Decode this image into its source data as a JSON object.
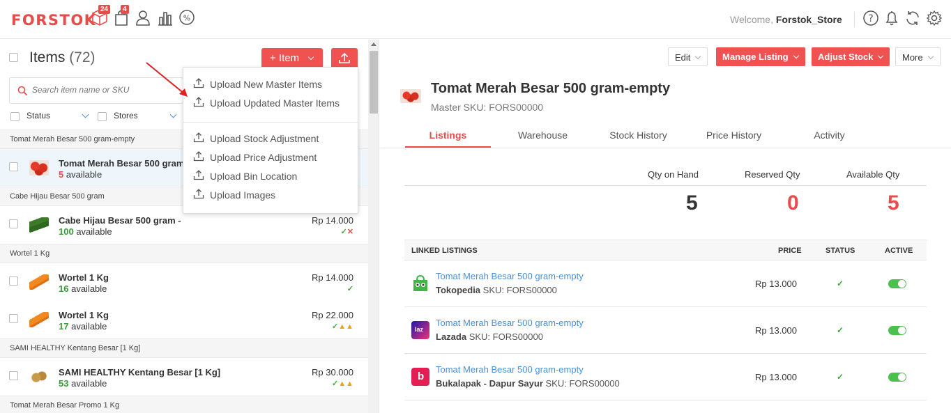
{
  "topbar": {
    "logo": "FORSTOK",
    "orders_badge": "24",
    "returns_badge": "4",
    "welcome_prefix": "Welcome,",
    "store_name": "Forstok_Store",
    "icons": [
      "box-icon",
      "bag-icon",
      "user-icon",
      "chart-icon",
      "discount-icon",
      "help-icon",
      "bell-icon",
      "sync-icon",
      "gear-icon"
    ]
  },
  "items_panel": {
    "title": "Items",
    "count": "(72)",
    "add_item_label": "+ Item",
    "search_placeholder": "Search item name or SKU",
    "filters": [
      {
        "label": "Status"
      },
      {
        "label": "Stores"
      }
    ],
    "groups": [
      {
        "name": "Tomat Merah Besar 500 gram-empty"
      },
      {
        "name": "Cabe Hijau Besar 500 gram"
      },
      {
        "name": "Wortel 1 Kg"
      },
      {
        "name": "SAMI HEALTHY Kentang Besar [1 Kg]"
      },
      {
        "name": "Tomat Merah Besar Promo 1 Kg"
      }
    ],
    "rows": [
      {
        "name": "Tomat Merah Besar 500 gram-empty",
        "qty": "5",
        "avail": "available",
        "price": ""
      },
      {
        "name": "Cabe Hijau Besar 500 gram -",
        "qty": "100",
        "avail": "available",
        "price": "Rp 14.000"
      },
      {
        "name": "Wortel 1 Kg",
        "qty": "16",
        "avail": "available",
        "price": "Rp 14.000"
      },
      {
        "name": "Wortel 1 Kg",
        "qty": "17",
        "avail": "available",
        "price": "Rp 22.000"
      },
      {
        "name": "SAMI HEALTHY Kentang Besar [1 Kg]",
        "qty": "53",
        "avail": "available",
        "price": "Rp 30.000"
      }
    ]
  },
  "upload_menu": {
    "items": [
      {
        "label": "Upload New Master Items"
      },
      {
        "label": "Upload Updated Master Items"
      },
      {
        "label": "Upload Stock Adjustment"
      },
      {
        "label": "Upload Price Adjustment"
      },
      {
        "label": "Upload Bin Location"
      },
      {
        "label": "Upload Images"
      }
    ]
  },
  "detail": {
    "buttons": {
      "edit": "Edit",
      "manage_listing": "Manage Listing",
      "adjust_stock": "Adjust Stock",
      "more": "More"
    },
    "title": "Tomat Merah Besar 500 gram-empty",
    "master_sku": "Master SKU: FORS00000",
    "tabs": [
      {
        "label": "Listings"
      },
      {
        "label": "Warehouse"
      },
      {
        "label": "Stock History"
      },
      {
        "label": "Price History"
      },
      {
        "label": "Activity"
      }
    ],
    "qty": {
      "on_hand_label": "Qty on Hand",
      "on_hand": "5",
      "reserved_label": "Reserved Qty",
      "reserved": "0",
      "available_label": "Available Qty",
      "available": "5"
    },
    "listings_header": {
      "linked": "LINKED LISTINGS",
      "price": "PRICE",
      "status": "STATUS",
      "active": "ACTIVE"
    },
    "listings": [
      {
        "name": "Tomat Merah Besar 500 gram-empty",
        "store": "Tokopedia",
        "sku": "SKU: FORS00000",
        "price": "Rp  13.000",
        "status": "✓",
        "active": true
      },
      {
        "name": "Tomat Merah Besar 500 gram-empty",
        "store": "Lazada",
        "sku": "SKU: FORS00000",
        "price": "Rp  13.000",
        "status": "✓",
        "active": true
      },
      {
        "name": "Tomat Merah Besar 500 gram-empty",
        "store": "Bukalapak - Dapur Sayur",
        "sku": "SKU: FORS00000",
        "price": "Rp  13.000",
        "status": "✓",
        "active": true
      }
    ]
  },
  "colors": {
    "brand": "#e94b4b",
    "link": "#4a90d9",
    "success": "#3aaa3a",
    "toggle": "#4cc04c"
  }
}
